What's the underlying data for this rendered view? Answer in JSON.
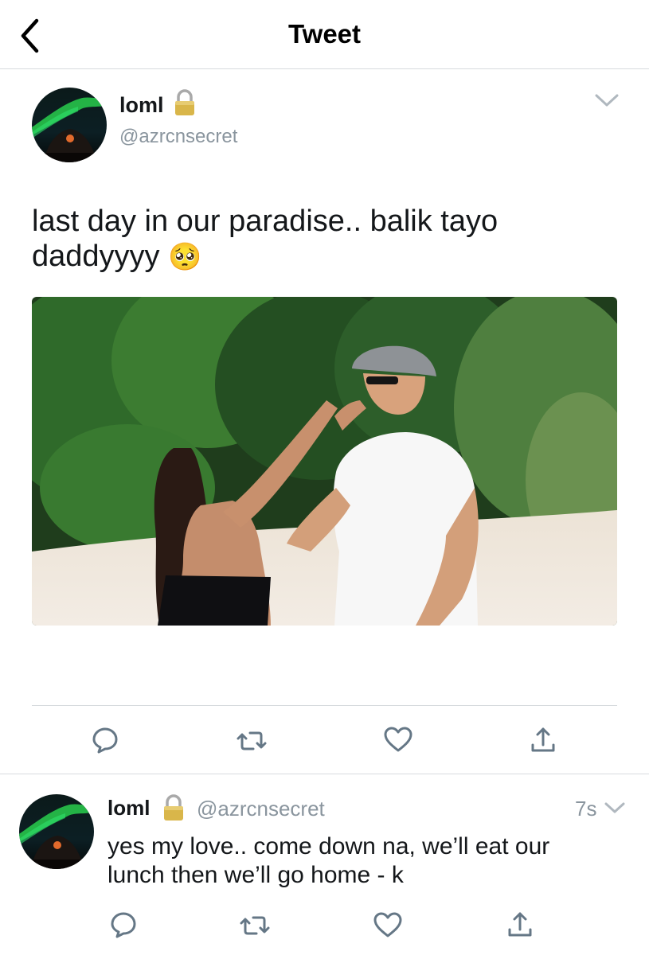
{
  "header": {
    "title": "Tweet"
  },
  "main_tweet": {
    "name": "loml",
    "handle": "@azrcnsecret",
    "text_line1": "last day in our paradise.. balik tayo",
    "text_line2": "daddyyyy",
    "emoji": "🥺",
    "media_description": "photo"
  },
  "reply_tweet": {
    "name": "loml",
    "handle": "@azrcnsecret",
    "time": "7s",
    "text_line1": "yes my love.. come down na, we’ll eat our",
    "text_line2": "lunch then we’ll go home - k"
  },
  "icons": {
    "back": "chevron-left-icon",
    "lock": "lock-icon",
    "caret": "chevron-down-icon",
    "reply": "reply-icon",
    "retweet": "retweet-icon",
    "like": "heart-icon",
    "share": "share-icon"
  },
  "colors": {
    "text": "#14171a",
    "secondary": "#8a959e",
    "icon": "#657786",
    "border": "#d7dbde"
  }
}
